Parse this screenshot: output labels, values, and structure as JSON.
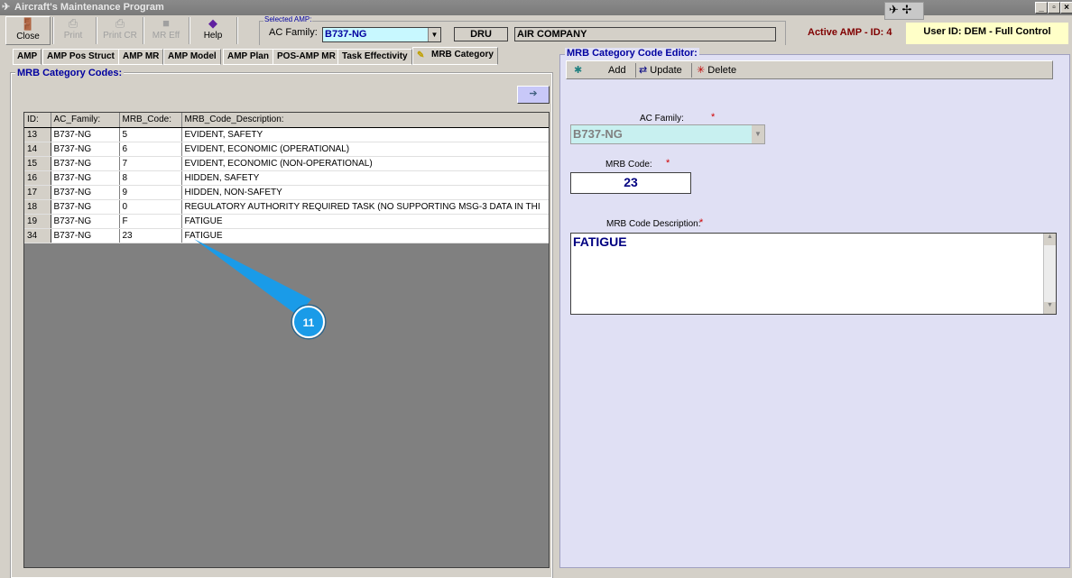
{
  "window": {
    "title": "Aircraft's Maintenance Program"
  },
  "toolbar": [
    {
      "label": "Close",
      "icon": "door-icon",
      "enabled": true
    },
    {
      "label": "Print",
      "icon": "printer-icon",
      "enabled": false
    },
    {
      "label": "Print CR",
      "icon": "printer-icon",
      "enabled": false
    },
    {
      "label": "MR Eff",
      "icon": "square-icon",
      "enabled": false
    },
    {
      "label": "Help",
      "icon": "help-book-icon",
      "enabled": true
    }
  ],
  "selected_amp": {
    "group_label": "Selected AMP:",
    "ac_family_label": "AC Family:",
    "ac_family_value": "B737-NG",
    "operator_code": "DRU",
    "company": "AIR COMPANY"
  },
  "status": {
    "active_amp": "Active AMP - ID: 4",
    "user": "User ID: DEM - Full Control"
  },
  "tabs": [
    "AMP",
    "AMP Pos Struct",
    "AMP MR",
    "AMP Model",
    "AMP Plan",
    "POS-AMP MR",
    "Task Effectivity",
    "MRB Category"
  ],
  "left": {
    "title": "MRB Category Codes:",
    "columns": [
      "ID:",
      "AC_Family:",
      "MRB_Code:",
      "MRB_Code_Description:"
    ],
    "rows": [
      [
        "13",
        "B737-NG",
        "5",
        "EVIDENT, SAFETY"
      ],
      [
        "14",
        "B737-NG",
        "6",
        "EVIDENT, ECONOMIC (OPERATIONAL)"
      ],
      [
        "15",
        "B737-NG",
        "7",
        "EVIDENT, ECONOMIC (NON-OPERATIONAL)"
      ],
      [
        "16",
        "B737-NG",
        "8",
        "HIDDEN, SAFETY"
      ],
      [
        "17",
        "B737-NG",
        "9",
        "HIDDEN, NON-SAFETY"
      ],
      [
        "18",
        "B737-NG",
        "0",
        "REGULATORY AUTHORITY REQUIRED TASK (NO SUPPORTING MSG-3 DATA IN THI"
      ],
      [
        "19",
        "B737-NG",
        "F",
        "FATIGUE"
      ],
      [
        "34",
        "B737-NG",
        "23",
        "FATIGUE"
      ]
    ]
  },
  "editor": {
    "title": "MRB Category Code Editor:",
    "add": "Add",
    "update": "Update",
    "delete": "Delete",
    "ac_family_label": "AC Family:",
    "ac_family_value": "B737-NG",
    "mrb_code_label": "MRB Code:",
    "mrb_code_value": "23",
    "desc_label": "MRB Code Description:",
    "desc_value": "FATIGUE",
    "required": "*"
  },
  "callout": {
    "number": "11",
    "color": "#1a9be8"
  }
}
